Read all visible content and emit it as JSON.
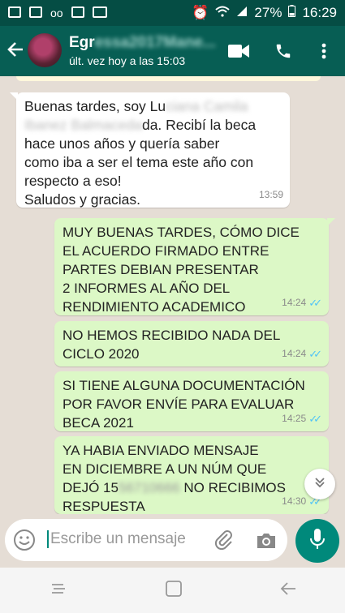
{
  "status_bar": {
    "battery": "27%",
    "time": "16:29"
  },
  "header": {
    "contact_name_visible": "Egr",
    "contact_name_hidden": "essa2017Mane...",
    "last_seen": "últ. vez hoy a las 15:03"
  },
  "messages": [
    {
      "direction": "incoming",
      "lines": [
        "Buenas tardes, soy Lu",
        "da. Recibí la beca",
        "hace unos años y quería saber",
        "como iba a ser el tema este año con",
        "respecto a eso!",
        "Saludos y gracias."
      ],
      "blurred": [
        "ciana Camila",
        "Ibanez Balmaceda"
      ],
      "time": "13:59"
    },
    {
      "direction": "outgoing",
      "lines": [
        "MUY BUENAS TARDES, CÓMO DICE",
        "EL ACUERDO FIRMADO ENTRE",
        "PARTES DEBIAN PRESENTAR",
        "2 INFORMES AL AÑO DEL",
        "RENDIMIENTO ACADEMICO"
      ],
      "time": "14:24"
    },
    {
      "direction": "outgoing",
      "lines": [
        "NO HEMOS RECIBIDO NADA DEL",
        "CICLO 2020"
      ],
      "time": "14:24"
    },
    {
      "direction": "outgoing",
      "lines": [
        "SI TIENE ALGUNA DOCUMENTACIÓN",
        "POR FAVOR ENVÍE PARA EVALUAR",
        "BECA 2021"
      ],
      "time": "14:25"
    },
    {
      "direction": "outgoing",
      "lines": [
        "YA HABIA ENVIADO MENSAJE",
        "EN DICIEMBRE A UN NÚM QUE",
        "DEJÓ 15",
        " NO RECIBIMOS",
        "RESPUESTA"
      ],
      "blurred": [
        "56710666"
      ],
      "time": "14:30"
    }
  ],
  "composer": {
    "placeholder": "Escribe un mensaje"
  },
  "colors": {
    "header": "#075e54",
    "status_bar": "#054d44",
    "outgoing": "#dcf8c6",
    "incoming": "#ffffff",
    "accent": "#00897b",
    "chat_bg": "#e5ddd5"
  }
}
